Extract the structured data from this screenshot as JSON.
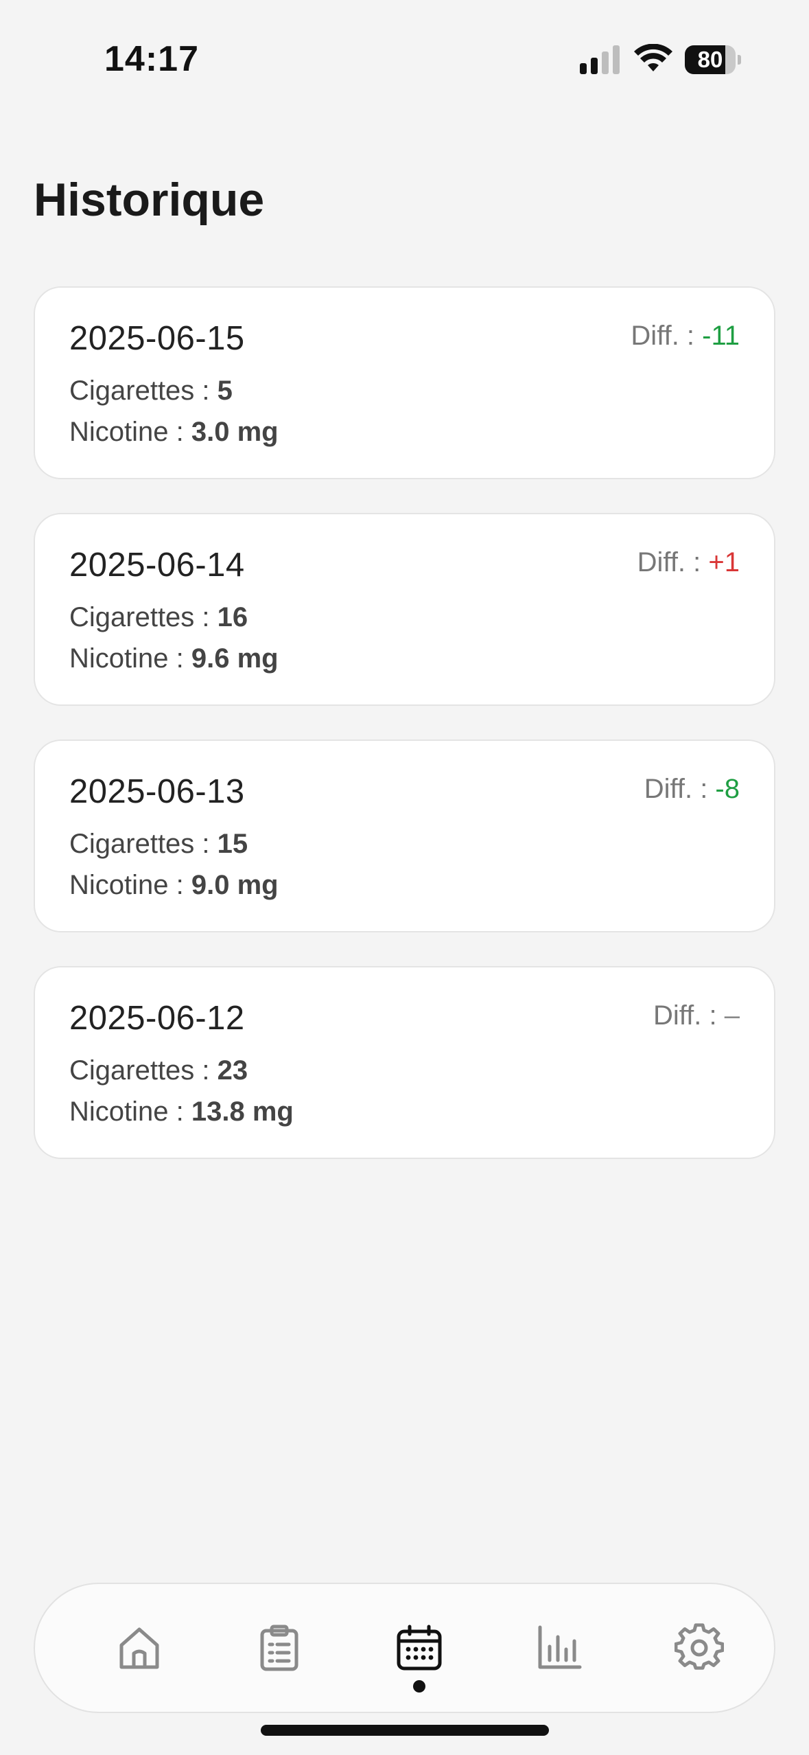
{
  "status_bar": {
    "time": "14:17",
    "battery_percent": "80",
    "battery_level": 0.8
  },
  "page": {
    "title": "Historique"
  },
  "entries": [
    {
      "date": "2025-06-15",
      "diff_label": "Diff. : ",
      "diff_value": "-11",
      "diff_kind": "neg",
      "cigarettes_label": "Cigarettes : ",
      "cigarettes_value": "5",
      "nicotine_label": "Nicotine : ",
      "nicotine_value": "3.0 mg"
    },
    {
      "date": "2025-06-14",
      "diff_label": "Diff. : ",
      "diff_value": "+1",
      "diff_kind": "pos",
      "cigarettes_label": "Cigarettes : ",
      "cigarettes_value": "16",
      "nicotine_label": "Nicotine : ",
      "nicotine_value": "9.6 mg"
    },
    {
      "date": "2025-06-13",
      "diff_label": "Diff. : ",
      "diff_value": "-8",
      "diff_kind": "neg",
      "cigarettes_label": "Cigarettes : ",
      "cigarettes_value": "15",
      "nicotine_label": "Nicotine : ",
      "nicotine_value": "9.0 mg"
    },
    {
      "date": "2025-06-12",
      "diff_label": "Diff. : ",
      "diff_value": "–",
      "diff_kind": "neutral",
      "cigarettes_label": "Cigarettes : ",
      "cigarettes_value": "23",
      "nicotine_label": "Nicotine : ",
      "nicotine_value": "13.8 mg"
    }
  ],
  "tab_bar": {
    "tabs": [
      {
        "icon": "home-icon",
        "active": false
      },
      {
        "icon": "clipboard-icon",
        "active": false
      },
      {
        "icon": "calendar-icon",
        "active": true
      },
      {
        "icon": "bar-chart-icon",
        "active": false
      },
      {
        "icon": "gear-icon",
        "active": false
      }
    ]
  },
  "colors": {
    "background": "#f4f4f4",
    "card": "#ffffff",
    "diff_negative": "#1e9e42",
    "diff_positive": "#d93636",
    "tab_inactive": "#8a8a8a",
    "tab_active": "#111111"
  }
}
